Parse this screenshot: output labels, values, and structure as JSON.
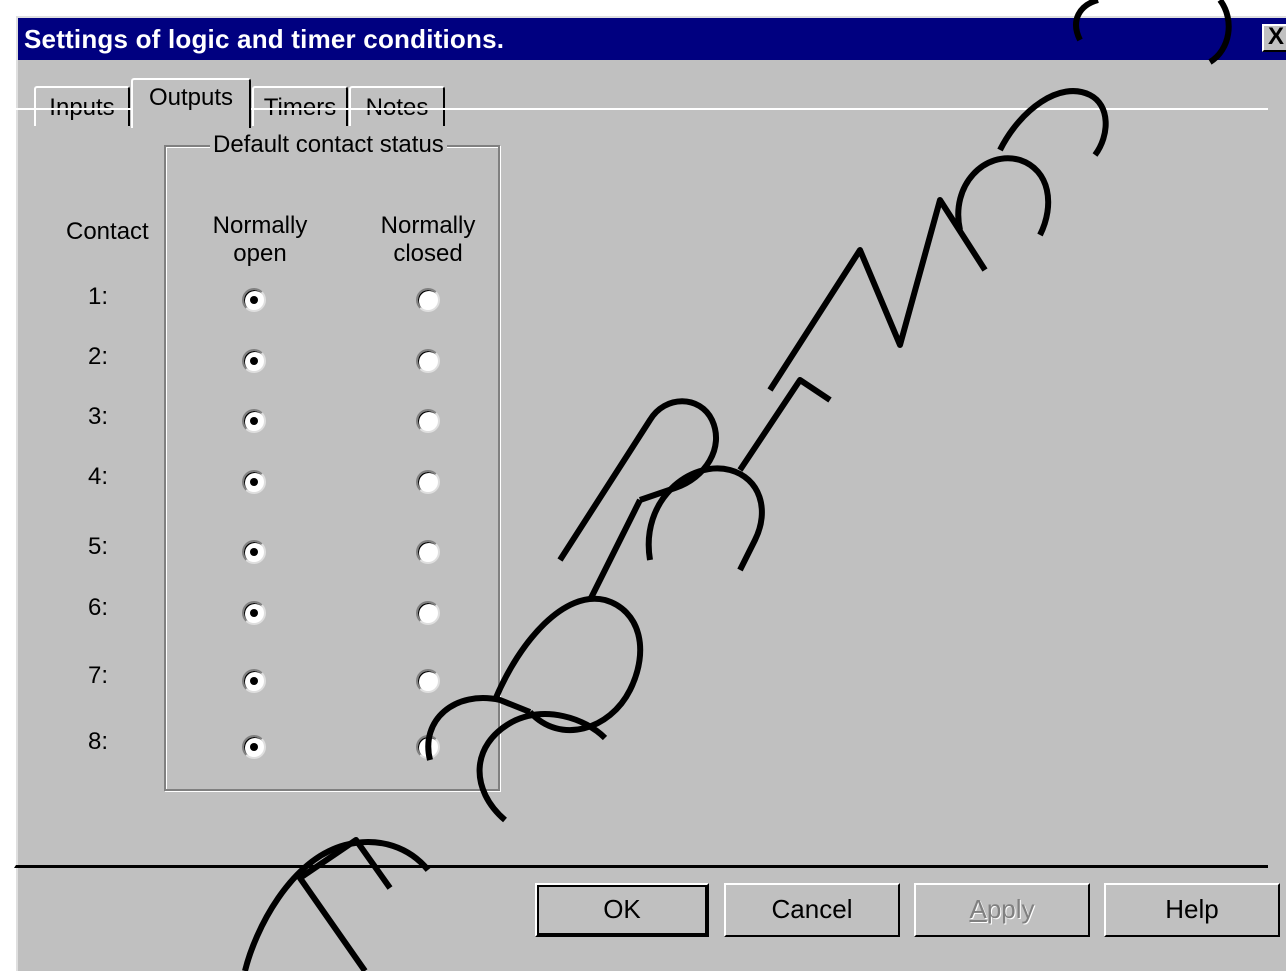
{
  "window": {
    "title": "Settings of logic and timer conditions.",
    "close_label": "X"
  },
  "tabs": [
    {
      "label": "Inputs",
      "active": false
    },
    {
      "label": "Outputs",
      "active": true
    },
    {
      "label": "Timers",
      "active": false
    },
    {
      "label": "Notes",
      "active": false
    }
  ],
  "group": {
    "title": "Default contact status",
    "contact_header": "Contact",
    "col_open_line1": "Normally",
    "col_open_line2": "open",
    "col_closed_line1": "Normally",
    "col_closed_line2": "closed"
  },
  "contacts": [
    {
      "label": "1:",
      "status": "normally_open"
    },
    {
      "label": "2:",
      "status": "normally_open"
    },
    {
      "label": "3:",
      "status": "normally_open"
    },
    {
      "label": "4:",
      "status": "normally_open"
    },
    {
      "label": "5:",
      "status": "normally_open"
    },
    {
      "label": "6:",
      "status": "normally_open"
    },
    {
      "label": "7:",
      "status": "normally_open"
    },
    {
      "label": "8:",
      "status": "normally_open"
    }
  ],
  "buttons": {
    "ok": "OK",
    "cancel": "Cancel",
    "apply_mnemonic": "A",
    "apply_rest": "pply",
    "help": "Help"
  },
  "colors": {
    "titlebar": "#000080",
    "face": "#c0c0c0",
    "watermark": "#000000"
  }
}
